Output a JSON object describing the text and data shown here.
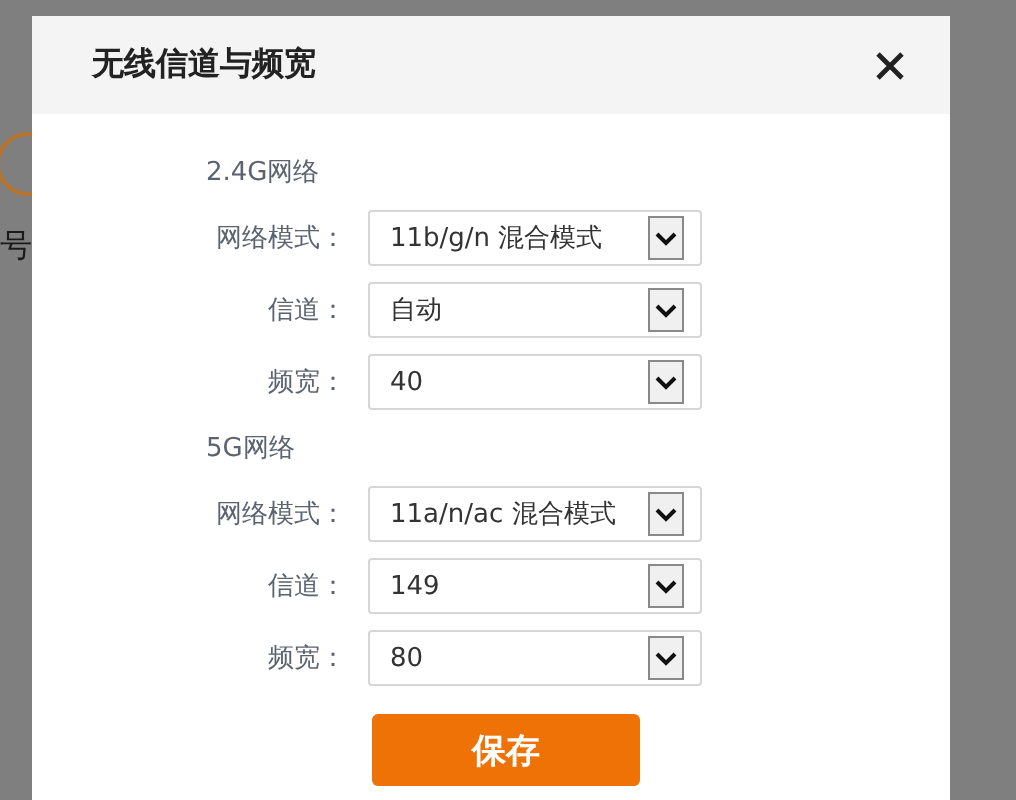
{
  "background": {
    "side_label": "号"
  },
  "dialog": {
    "title": "无线信道与频宽",
    "sections": [
      {
        "title": "2.4G网络",
        "fields": [
          {
            "label": "网络模式：",
            "value": "11b/g/n 混合模式"
          },
          {
            "label": "信道：",
            "value": "自动"
          },
          {
            "label": "频宽：",
            "value": "40"
          }
        ]
      },
      {
        "title": "5G网络",
        "fields": [
          {
            "label": "网络模式：",
            "value": "11a/n/ac 混合模式"
          },
          {
            "label": "信道：",
            "value": "149"
          },
          {
            "label": "频宽：",
            "value": "80"
          }
        ]
      }
    ],
    "save_button": "保存"
  }
}
